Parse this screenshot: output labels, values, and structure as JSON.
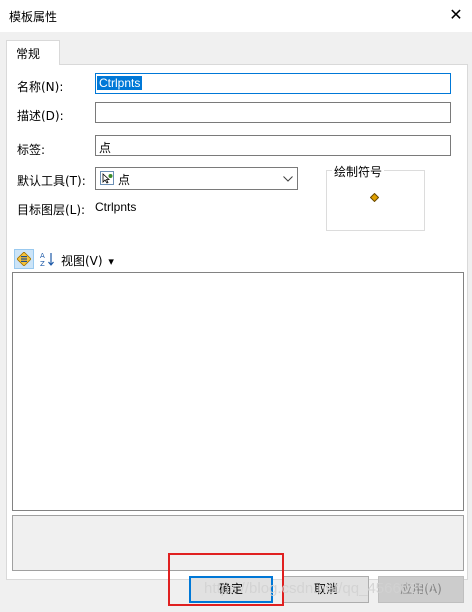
{
  "window": {
    "title": "模板属性",
    "close_symbol": "✕"
  },
  "tabs": [
    {
      "label": "常规"
    }
  ],
  "form": {
    "name_label": "名称(N):",
    "name_value": "Ctrlpnts",
    "description_label": "描述(D):",
    "description_value": "",
    "tags_label": "标签:",
    "tags_value": "点",
    "default_tool_label": "默认工具(T):",
    "default_tool_value": "点",
    "target_layer_label": "目标图层(L):",
    "target_layer_value": "Ctrlpnts"
  },
  "symbol_group": {
    "label": "绘制符号",
    "symbol_color": "#e0a000"
  },
  "view_toolbar": {
    "view_label": "视图(V)",
    "dropdown_arrow": "▾"
  },
  "buttons": {
    "ok": "确定",
    "cancel": "取消",
    "apply": "应用(A)"
  },
  "watermark": "https://blog.csdn.net/qq_45660890",
  "colors": {
    "accent": "#0078d7",
    "highlight_box": "#e02020"
  }
}
